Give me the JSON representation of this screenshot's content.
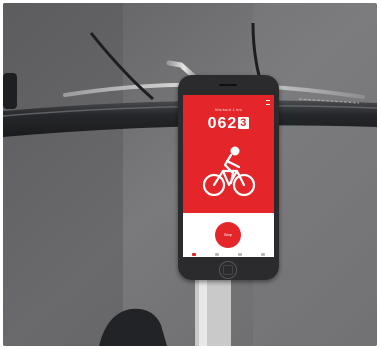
{
  "app": {
    "title": "Workout 1 km",
    "counter_main": "062",
    "counter_last": "3",
    "action_label": "Stop"
  },
  "colors": {
    "brand_red": "#e4262b",
    "phone_body": "#2b2b2e",
    "road": "#6e6e70",
    "handlebar": "#2a2b2e"
  },
  "icons": [
    "menu-icon",
    "cyclist-icon",
    "bike-tab-icon",
    "route-tab-icon",
    "location-tab-icon",
    "stats-tab-icon"
  ]
}
